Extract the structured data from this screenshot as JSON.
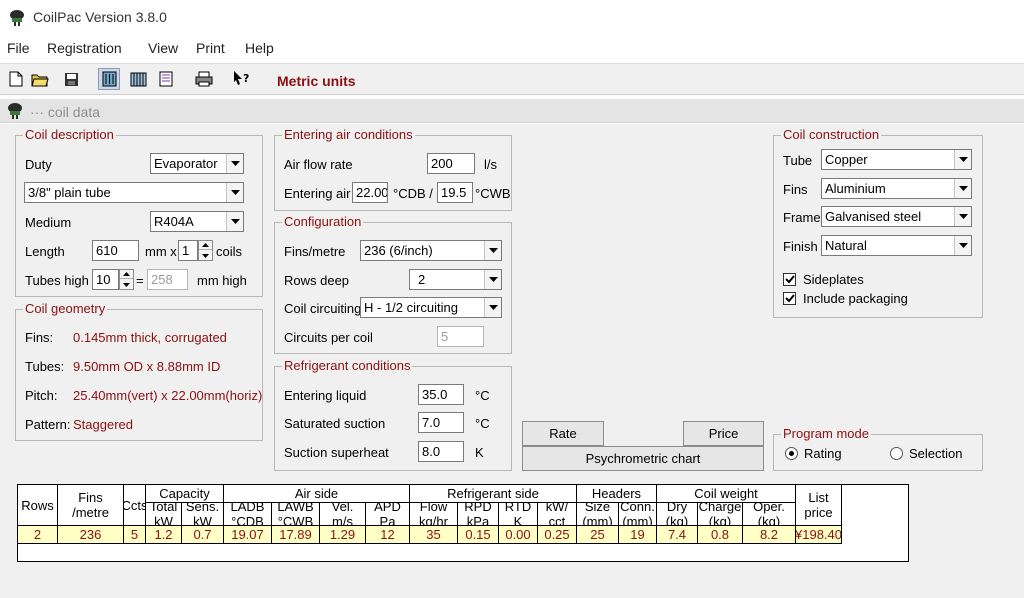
{
  "window": {
    "title": "CoilPac Version 3.8.0"
  },
  "menu": {
    "items": [
      "File",
      "Registration",
      "View",
      "Print",
      "Help"
    ]
  },
  "toolbar": {
    "units_label": "Metric units"
  },
  "child_window": {
    "title": "··· coil data"
  },
  "coil_description": {
    "title": "Coil description",
    "duty_label": "Duty",
    "duty_value": "Evaporator",
    "tube_type": "3/8\" plain tube",
    "medium_label": "Medium",
    "medium_value": "R404A",
    "length_label": "Length",
    "length_value": "610",
    "length_unit": "mm x",
    "coils_value": "1",
    "coils_label": "coils",
    "tubes_high_label": "Tubes high",
    "tubes_high_value": "10",
    "mm_high_value": "258",
    "mm_high_label": "mm high"
  },
  "coil_geometry": {
    "title": "Coil geometry",
    "fins_label": "Fins:",
    "fins_value": "0.145mm thick, corrugated",
    "tubes_label": "Tubes:",
    "tubes_value": "9.50mm OD x 8.88mm ID",
    "pitch_label": "Pitch:",
    "pitch_value": "25.40mm(vert) x 22.00mm(horiz)",
    "pattern_label": "Pattern:",
    "pattern_value": "Staggered"
  },
  "entering_air": {
    "title": "Entering air conditions",
    "airflow_label": "Air flow rate",
    "airflow_value": "200",
    "airflow_unit": "l/s",
    "entering_air_label": "Entering air",
    "db_value": "22.00",
    "db_unit": "°CDB /",
    "wb_value": "19.5",
    "wb_unit": "°CWB"
  },
  "configuration": {
    "title": "Configuration",
    "fins_label": "Fins/metre",
    "fins_value": "236 (6/inch)",
    "rows_label": "Rows deep",
    "rows_value": "2",
    "circuiting_label": "Coil circuiting",
    "circuiting_value": "H - 1/2 circuiting",
    "circuits_label": "Circuits per coil",
    "circuits_value": "5"
  },
  "refrigerant": {
    "title": "Refrigerant conditions",
    "liquid_label": "Entering liquid",
    "liquid_value": "35.0",
    "liquid_unit": "°C",
    "suction_label": "Saturated suction",
    "suction_value": "7.0",
    "suction_unit": "°C",
    "superheat_label": "Suction superheat",
    "superheat_value": "8.0",
    "superheat_unit": "K"
  },
  "construction": {
    "title": "Coil construction",
    "tube_label": "Tube",
    "tube_value": "Copper",
    "fins_label": "Fins",
    "fins_value": "Aluminium",
    "frame_label": "Frame",
    "frame_value": "Galvanised steel",
    "finish_label": "Finish",
    "finish_value": "Natural",
    "sideplates_label": "Sideplates",
    "sideplates_checked": true,
    "packaging_label": "Include packaging",
    "packaging_checked": true
  },
  "buttons": {
    "rate": "Rate",
    "price": "Price",
    "psychrometric": "Psychrometric chart"
  },
  "program_mode": {
    "title": "Program mode",
    "rating_label": "Rating",
    "selection_label": "Selection",
    "selected": "Rating"
  },
  "results": {
    "group_headers": [
      "Capacity",
      "Air side",
      "Refrigerant side",
      "Headers",
      "Coil weight"
    ],
    "columns": [
      "Rows",
      "Fins\n/metre",
      "Ccts",
      "Total\nkW",
      "Sens.\nkW",
      "LADB\n°CDB",
      "LAWB\n°CWB",
      "Vel.\nm/s",
      "APD\nPa",
      "Flow\nkg/hr",
      "RPD\nkPa",
      "RTD\nK",
      "kW/\ncct",
      "Size\n(mm)",
      "Conn.\n(mm)",
      "Dry\n(kg)",
      "Charge\n(kg)",
      "Oper.\n(kg)",
      "List\nprice"
    ],
    "row": [
      "2",
      "236",
      "5",
      "1.2",
      "0.7",
      "19.07",
      "17.89",
      "1.29",
      "12",
      "35",
      "0.15",
      "0.00",
      "0.25",
      "25",
      "19",
      "7.4",
      "0.8",
      "8.2",
      "¥198.40"
    ]
  }
}
